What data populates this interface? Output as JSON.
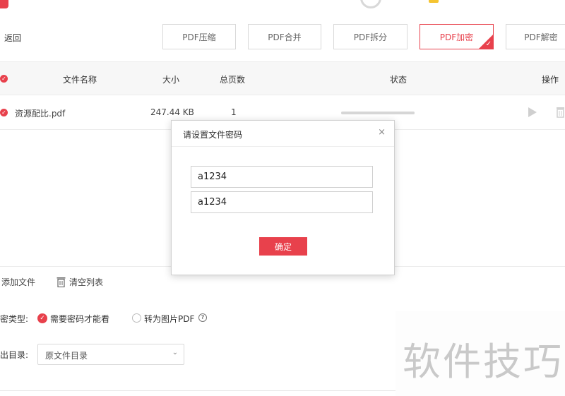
{
  "toolbar": {
    "back_label": "返回",
    "tools": [
      {
        "label": "PDF压缩"
      },
      {
        "label": "PDF合并"
      },
      {
        "label": "PDF拆分"
      },
      {
        "label": "PDF加密",
        "active": true
      },
      {
        "label": "PDF解密"
      }
    ]
  },
  "table": {
    "headers": {
      "name": "文件名称",
      "size": "大小",
      "pages": "总页数",
      "status": "状态",
      "action": "操作"
    },
    "rows": [
      {
        "name": "资源配比.pdf",
        "size": "247.44 KB",
        "pages": "1"
      }
    ]
  },
  "actions": {
    "add_file": "添加文件",
    "clear_list": "清空列表"
  },
  "settings": {
    "type_label": "密类型:",
    "option_password": "需要密码才能看",
    "option_image": "转为图片PDF",
    "output_label": "出目录:",
    "output_value": "原文件目录"
  },
  "modal": {
    "title": "请设置文件密码",
    "password_1": "a1234",
    "password_2": "a1234",
    "confirm_label": "确定"
  },
  "watermark": "软件技巧",
  "colors": {
    "accent": "#e8414c"
  }
}
